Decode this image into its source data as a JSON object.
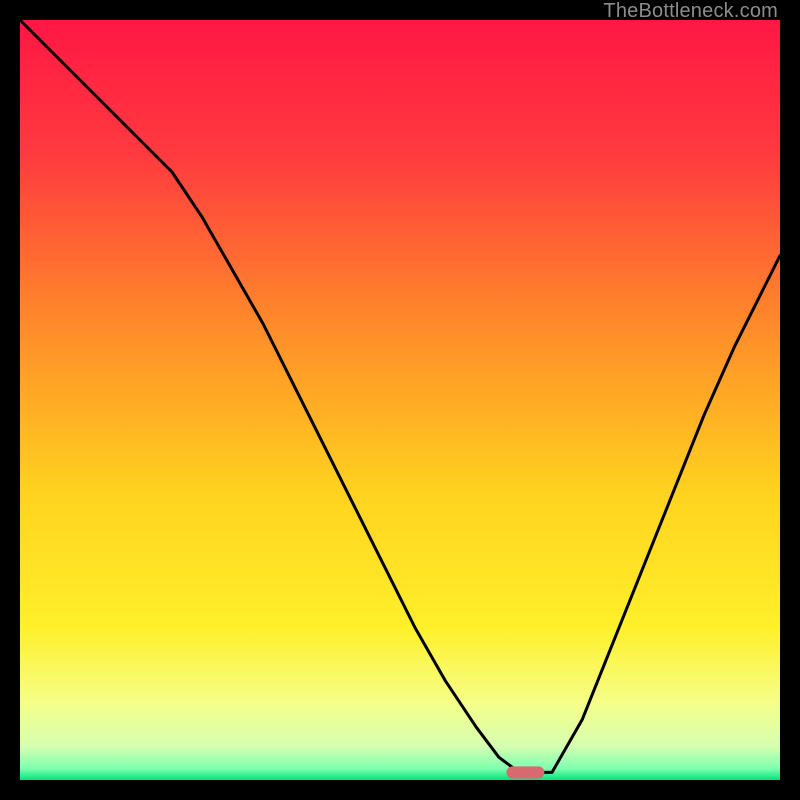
{
  "watermark": "TheBottleneck.com",
  "chart_data": {
    "type": "line",
    "title": "",
    "xlabel": "",
    "ylabel": "",
    "xlim": [
      0,
      100
    ],
    "ylim": [
      0,
      100
    ],
    "grid": false,
    "series": [
      {
        "name": "curve",
        "color": "#000000",
        "x": [
          0,
          5,
          10,
          15,
          20,
          24,
          28,
          32,
          36,
          40,
          44,
          48,
          52,
          56,
          60,
          63,
          65,
          67,
          69,
          70,
          74,
          78,
          82,
          86,
          90,
          94,
          98,
          100
        ],
        "y": [
          100,
          95,
          90,
          85,
          80,
          74,
          67,
          60,
          52,
          44,
          36,
          28,
          20,
          13,
          7,
          3,
          1.5,
          1,
          1,
          1,
          8,
          18,
          28,
          38,
          48,
          57,
          65,
          69
        ]
      }
    ],
    "marker": {
      "name": "optimum-pill",
      "x_center": 66.5,
      "y_center": 1,
      "width": 5,
      "height": 1.6,
      "color": "#d86a6f"
    },
    "background_gradient": {
      "stops": [
        {
          "pos": 0.0,
          "color": "#ff1744"
        },
        {
          "pos": 0.18,
          "color": "#ff3b3f"
        },
        {
          "pos": 0.4,
          "color": "#ff8a2a"
        },
        {
          "pos": 0.62,
          "color": "#ffd21f"
        },
        {
          "pos": 0.8,
          "color": "#fff02a"
        },
        {
          "pos": 0.9,
          "color": "#f5ff8a"
        },
        {
          "pos": 0.955,
          "color": "#d6ffb0"
        },
        {
          "pos": 0.985,
          "color": "#7fffb0"
        },
        {
          "pos": 1.0,
          "color": "#00e47a"
        }
      ]
    }
  }
}
